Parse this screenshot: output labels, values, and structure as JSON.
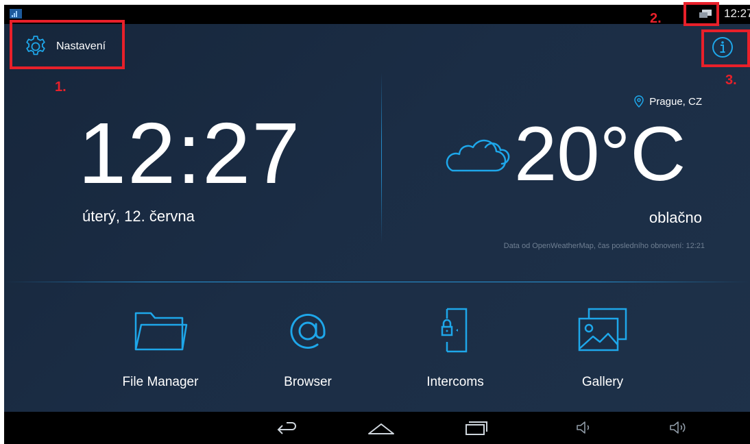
{
  "status_bar": {
    "time": "12:27"
  },
  "settings": {
    "label": "Nastavení",
    "icon": "gear-icon"
  },
  "info": {
    "icon": "info-icon"
  },
  "clock": {
    "time": "12:27",
    "date": "úterý, 12. června"
  },
  "weather": {
    "location": "Prague, CZ",
    "temperature": "20°C",
    "condition": "oblačno",
    "attribution": "Data od OpenWeatherMap, čas posledního obnovení: 12:21",
    "icon": "cloud-icon"
  },
  "apps": [
    {
      "label": "File Manager",
      "icon": "folder-icon"
    },
    {
      "label": "Browser",
      "icon": "at-icon"
    },
    {
      "label": "Intercoms",
      "icon": "door-lock-icon"
    },
    {
      "label": "Gallery",
      "icon": "gallery-icon"
    }
  ],
  "navbar": {
    "buttons": [
      "back-icon",
      "home-icon",
      "recents-icon",
      "volume-down-icon",
      "volume-up-icon"
    ]
  },
  "annotations": [
    {
      "number": "1."
    },
    {
      "number": "2."
    },
    {
      "number": "3."
    }
  ],
  "colors": {
    "accent": "#1ea7ea",
    "background": "#1b2d45",
    "annotation": "#e8202a"
  }
}
